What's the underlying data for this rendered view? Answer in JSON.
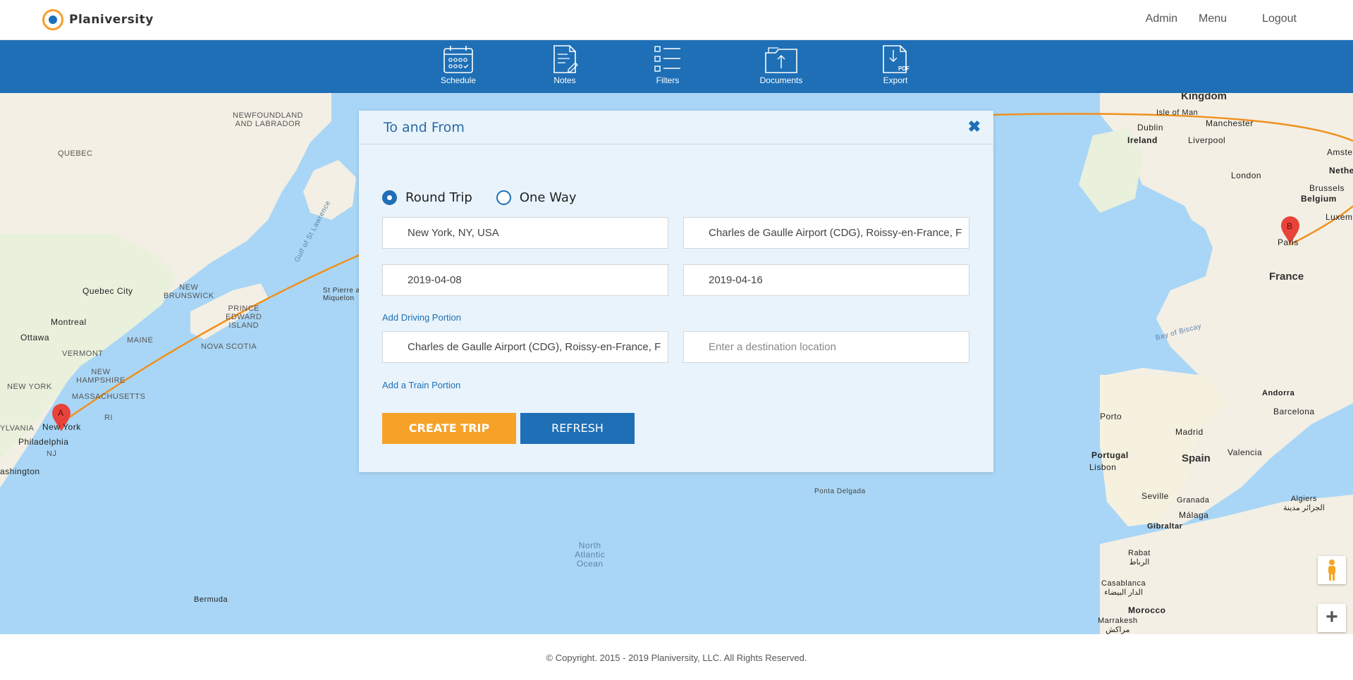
{
  "brand": {
    "name": "Planiversity"
  },
  "nav": {
    "admin": "Admin",
    "menu": "Menu",
    "logout": "Logout"
  },
  "toolbar": {
    "schedule": "Schedule",
    "notes": "Notes",
    "filters": "Filters",
    "documents": "Documents",
    "export": "Export"
  },
  "map": {
    "labels": {
      "newfoundland": "NEWFOUNDLAND\nAND LABRADOR",
      "quebec": "QUEBEC",
      "quebec_city": "Quebec City",
      "montreal": "Montreal",
      "ottawa": "Ottawa",
      "new_brunswick": "NEW\nBRUNSWICK",
      "maine": "MAINE",
      "vermont": "VERMONT",
      "new_hampshire": "NEW\nHAMPSHIRE",
      "massachusetts": "MASSACHUSETTS",
      "new_york_state": "NEW YORK",
      "new_york": "New York",
      "philadelphia": "Philadelphia",
      "washington": "ashington",
      "pennsylvania": "YLVANIA",
      "nj": "NJ",
      "ri": "RI",
      "pei": "PRINCE\nEDWARD\nISLAND",
      "nova_scotia": "NOVA SCOTIA",
      "st_pierre": "St Pierre and\nMiquelon",
      "gulf": "Gulf of St Lawrence",
      "bermuda": "Bermuda",
      "ponta_delgada": "Ponta Delgada",
      "ocean": "North\nAtlantic\nOcean",
      "kingdom": "Kingdom",
      "isle_of_man": "Isle of Man",
      "ireland": "Ireland",
      "dublin": "Dublin",
      "manchester": "Manchester",
      "liverpool": "Liverpool",
      "london": "London",
      "amsterdam": "Amsterdam",
      "netherlands": "Netherl",
      "brussels": "Brussels",
      "belgium": "Belgium",
      "luxembourg": "Luxemb",
      "paris": "Paris",
      "france": "France",
      "bay_of_biscay": "Bay of Biscay",
      "andorra": "Andorra",
      "barcelona": "Barcelona",
      "porto": "Porto",
      "madrid": "Madrid",
      "portugal": "Portugal",
      "lisbon": "Lisbon",
      "spain": "Spain",
      "valencia": "Valencia",
      "seville": "Seville",
      "granada": "Granada",
      "malaga": "Málaga",
      "gibraltar": "Gibraltar",
      "algiers": "Algiers\nالجزائر مدينة",
      "rabat": "Rabat\nالرباط",
      "casablanca": "Casablanca\nالدار البيضاء",
      "morocco": "Morocco",
      "marrakesh": "Marrakesh\nمراكش"
    },
    "marker_a": "A",
    "marker_b": "B",
    "route_color": "#f0901d"
  },
  "modal": {
    "title": "To and From",
    "close": "✖",
    "trip_type": {
      "round": "Round Trip",
      "oneway": "One Way",
      "selected": "round"
    },
    "from": "New York, NY, USA",
    "to": "Charles de Gaulle Airport (CDG), Roissy-en-France, F",
    "depart_date": "2019-04-08",
    "return_date": "2019-04-16",
    "add_driving": "Add Driving Portion",
    "driving_from": "Charles de Gaulle Airport (CDG), Roissy-en-France, F",
    "driving_to_placeholder": "Enter a destination location",
    "add_train": "Add a Train Portion",
    "create": "CREATE TRIP",
    "refresh": "REFRESH"
  },
  "footer": {
    "copyright": "© Copyright. 2015 - 2019 Planiversity, LLC. All Rights Reserved."
  },
  "colors": {
    "brand_blue": "#1e6fb6",
    "accent_orange": "#f6a229"
  }
}
